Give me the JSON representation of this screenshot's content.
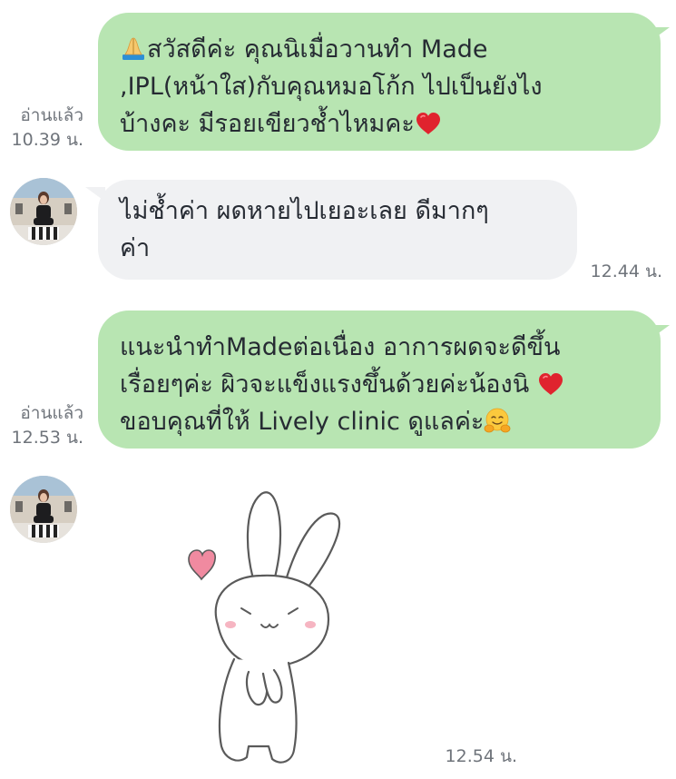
{
  "chat": {
    "messages": [
      {
        "direction": "outgoing",
        "lines": [
          "สวัสดีค่ะ คุณนิเมื่อวานทำ Made",
          ",IPL(หน้าใส)กับคุณหมอโก้ก ไปเป็นยังไง",
          "บ้างคะ มีรอยเขียวช้ำไหมคะ"
        ],
        "emoji": [
          "folded-hands",
          "red-heart"
        ],
        "read_label": "อ่านแล้ว",
        "time": "10.39 น."
      },
      {
        "direction": "incoming",
        "lines": [
          "ไม่ช้ำค่า ผดหายไปเยอะเลย ดีมากๆ",
          "ค่า"
        ],
        "time": "12.44 น."
      },
      {
        "direction": "outgoing",
        "lines": [
          " แนะนำทำMadeต่อเนื่อง อาการผดจะดีขึ้น",
          "เรื่อยๆค่ะ ผิวจะแข็งแรงขึ้นด้วยค่ะน้องนิ",
          "ขอบคุณที่ให้ Lively clinic ดูแลค่ะ"
        ],
        "emoji": [
          "red-heart",
          "hugging-face"
        ],
        "read_label": "อ่านแล้ว",
        "time": "12.53 น."
      },
      {
        "direction": "incoming",
        "type": "sticker",
        "sticker": "bunny-thank-you-sticker",
        "time": "12.54 น."
      }
    ],
    "colors": {
      "outgoing_bubble": "#b8e5b2",
      "incoming_bubble": "#f0f1f3",
      "meta_text": "#6f747b",
      "heart": "#e0232e"
    }
  }
}
